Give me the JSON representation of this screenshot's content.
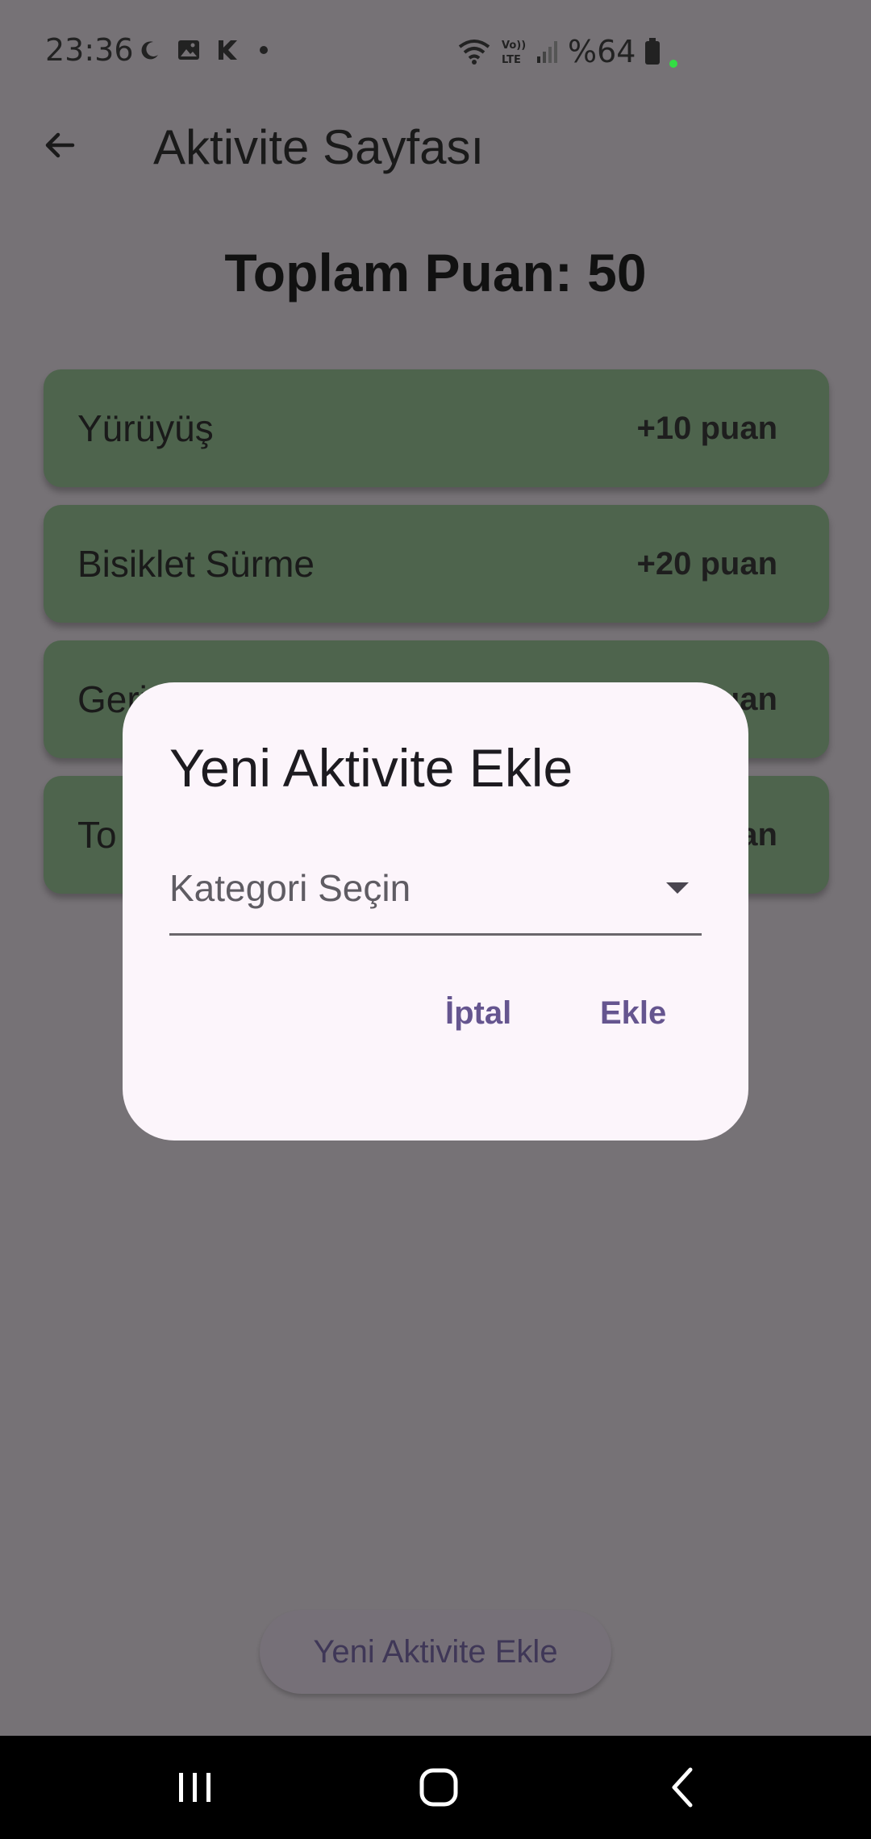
{
  "status_bar": {
    "time": "23:36",
    "battery": "%64",
    "icons": [
      "moon-icon",
      "image-icon",
      "app-k-icon",
      "dot-icon",
      "wifi-icon",
      "volte-icon",
      "signal-icon",
      "battery-icon"
    ]
  },
  "app_bar": {
    "title": "Aktivite Sayfası",
    "back_icon": "arrow-left-icon"
  },
  "total": {
    "label": "Toplam Puan: 50"
  },
  "activities": [
    {
      "name": "Yürüyüş",
      "points": "+10 puan"
    },
    {
      "name": "Bisiklet Sürme",
      "points": "+20 puan"
    },
    {
      "name": "Geri",
      "points": "uan"
    },
    {
      "name": "To",
      "points": "uan"
    }
  ],
  "add_button": {
    "label": "Yeni Aktivite Ekle"
  },
  "dialog": {
    "title": "Yeni Aktivite Ekle",
    "dropdown_placeholder": "Kategori Seçin",
    "cancel_label": "İptal",
    "add_label": "Ekle"
  },
  "colors": {
    "card": "#4e644d",
    "dialog_bg": "#fcf5fb",
    "accent": "#65558f",
    "scrim": "#767276"
  }
}
